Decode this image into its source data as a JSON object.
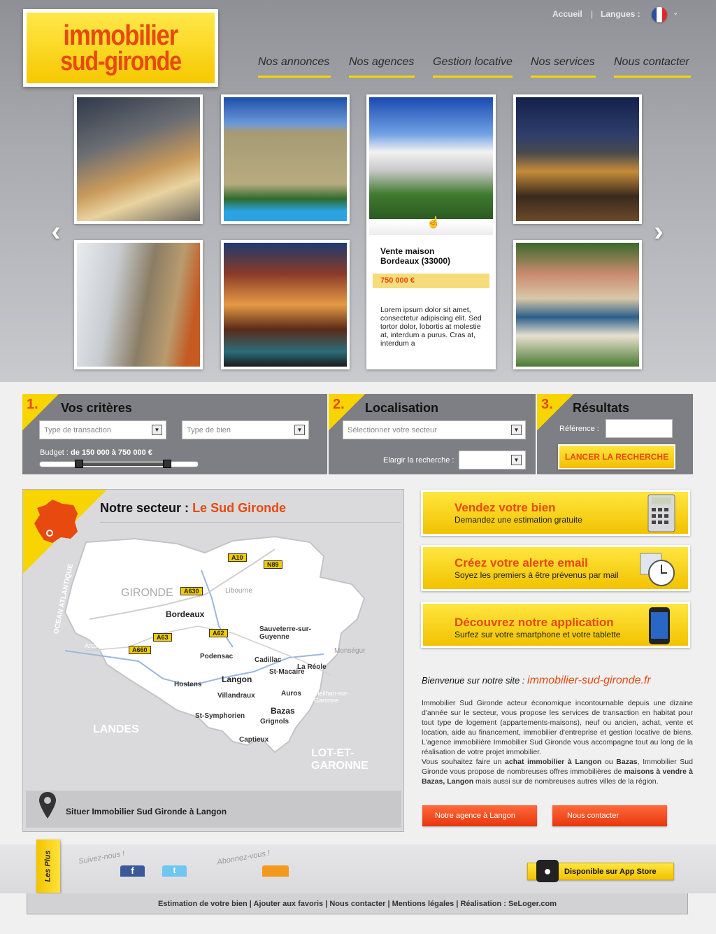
{
  "header": {
    "logo_line1": "immobilier",
    "logo_line2": "sud-gironde",
    "home_link": "Accueil",
    "separator": "|",
    "lang_label": "Langues :",
    "nav": [
      "Nos annonces",
      "Nos agences",
      "Gestion locative",
      "Nos services",
      "Nous contacter"
    ]
  },
  "listing_card": {
    "title_line1": "Vente maison",
    "title_line2": "Bordeaux (33000)",
    "price": "750 000 €",
    "description": "Lorem ipsum dolor sit amet, consectetur adipiscing elit. Sed tortor dolor, lobortis at molestie at, interdum a purus. Cras at, interdum a"
  },
  "search": {
    "step1_num": "1.",
    "step1_title": "Vos critères",
    "transaction_placeholder": "Type de transaction",
    "property_placeholder": "Type de bien",
    "budget_label": "Budget :",
    "budget_value": "de 150 000 à 750 000 €",
    "budget_range": [
      150000,
      750000
    ],
    "step2_num": "2.",
    "step2_title": "Localisation",
    "sector_placeholder": "Sélectionner votre secteur",
    "widen_label": "Elargir la recherche :",
    "step3_num": "3.",
    "step3_title": "Résultats",
    "reference_label": "Référence :",
    "search_button": "LANCER LA RECHERCHE"
  },
  "map": {
    "title": "Notre secteur :",
    "title_highlight": "Le Sud Gironde",
    "locate_text": "Situer Immobilier Sud Gironde à Langon",
    "places": [
      "Bordeaux",
      "Libourne",
      "Sauveterre-sur-Guyenne",
      "Podensac",
      "Cadillac",
      "La Réole",
      "Langon",
      "St-Macaire",
      "Monségur",
      "Hostens",
      "Villandraux",
      "Auros",
      "Bazas",
      "Grignols",
      "St-Symphorien",
      "Captieux",
      "Arcachon",
      "Meilhan-sur-Garonne"
    ],
    "regions": [
      "GIRONDE",
      "LANDES",
      "LOT-ET-GARONNE",
      "OCEAN ATLANTIQUE"
    ],
    "roads": [
      "A10",
      "N89",
      "A630",
      "A62",
      "A63",
      "A660"
    ]
  },
  "promos": [
    {
      "title": "Vendez votre bien",
      "subtitle": "Demandez une estimation gratuite"
    },
    {
      "title": "Créez votre alerte email",
      "subtitle": "Soyez les premiers à être prévenus par mail"
    },
    {
      "title": "Découvrez notre application",
      "subtitle": "Surfez sur votre smartphone et votre tablette"
    }
  ],
  "welcome": {
    "heading": "Bienvenue sur notre site :",
    "site": "immobilier-sud-gironde.fr",
    "p1": "Immobilier Sud Gironde acteur économique incontournable depuis une dizaine d'année sur le secteur, vous propose les services de transaction en habitat pour tout type de logement (appartements-maisons), neuf ou ancien, achat, vente et location, aide au financement, immobilier d'entreprise et gestion locative de biens. L'agence immobilière Immobilier Sud Gironde vous accompagne tout au long de la réalisation de votre projet immobilier.",
    "p2a": "Vous souhaitez faire un",
    "p2b": "achat immobilier à Langon",
    "p2c": "ou",
    "p2d": "Bazas",
    "p2e": ", Immobilier Sud Gironde vous propose de nombreuses offres immobilières de",
    "p2f": "maisons à vendre à Bazas",
    "p2g": ",",
    "p2h": "Langon",
    "p2i": "mais aussi sur de nombreuses autres villes de la région.",
    "btn1": "Notre agence à Langon",
    "btn2": "Nous contacter"
  },
  "footer": {
    "tab": "Les Plus",
    "follow": "Suivez-nous !",
    "subscribe": "Abonnez-vous !",
    "appstore": "Disponible sur App Store",
    "links": [
      "Estimation de votre bien",
      "Ajouter aux favoris",
      "Nous contacter",
      "Mentions légales",
      "Réalisation : SeLoger.com"
    ]
  },
  "colors": {
    "accent": "#e8490f",
    "yellow": "#f6c800",
    "panel": "#7e7f84"
  }
}
